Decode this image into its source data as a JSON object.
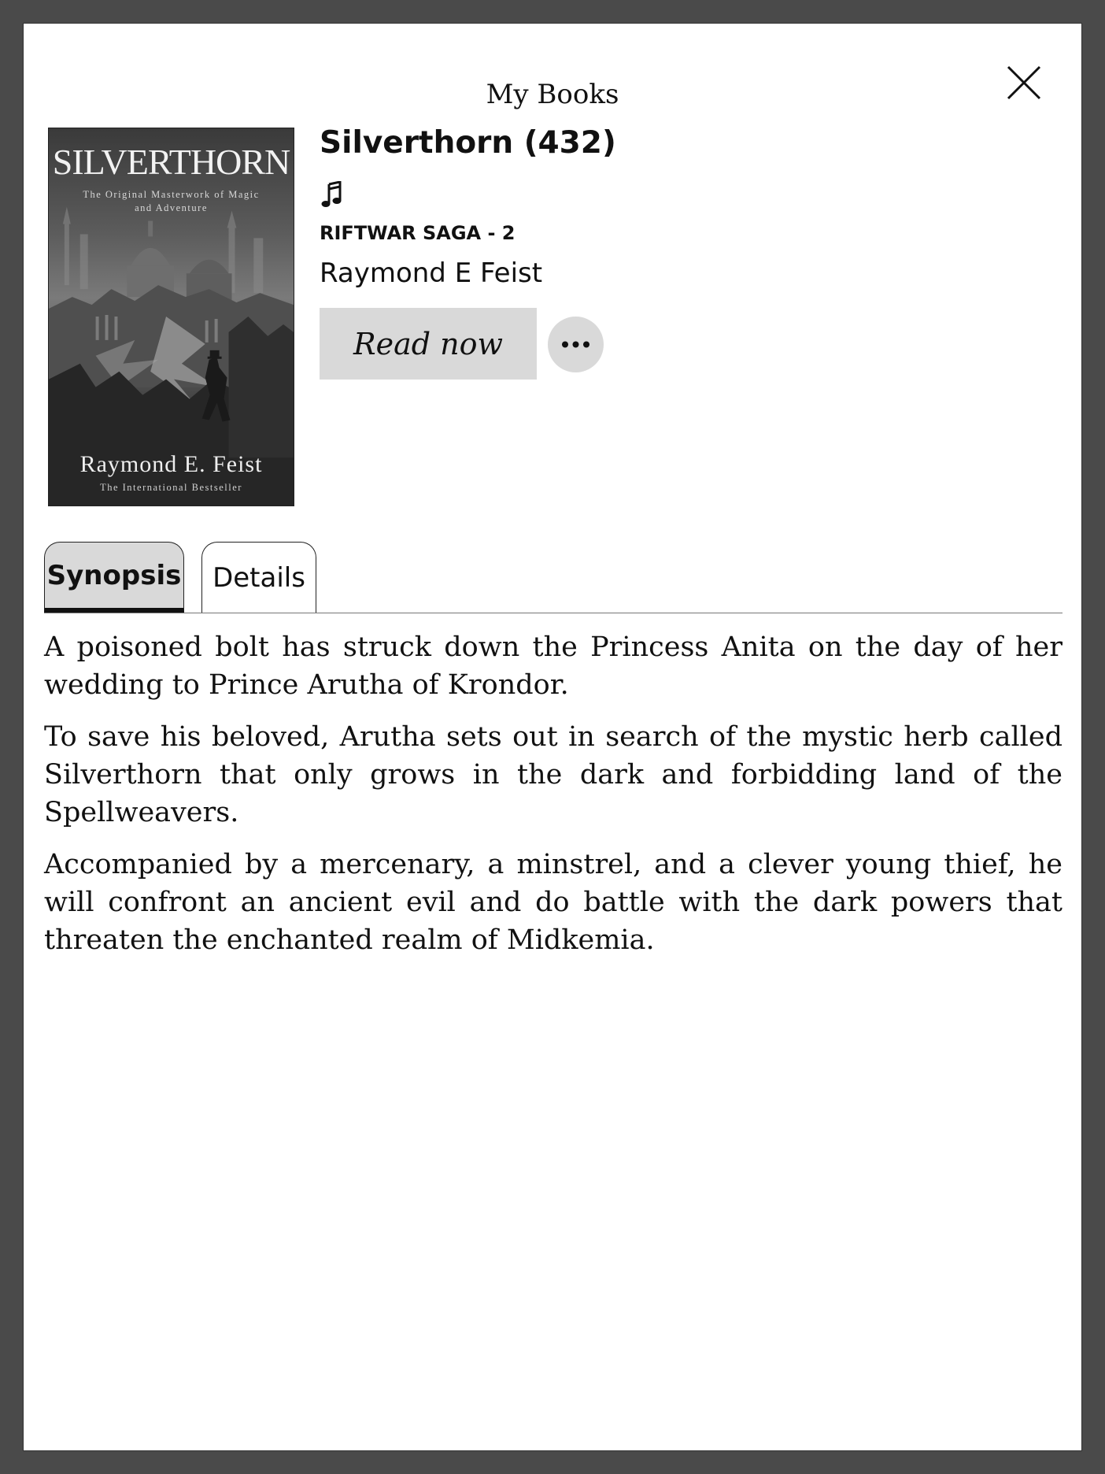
{
  "header": {
    "title": "My Books",
    "close_icon": "close-icon"
  },
  "cover": {
    "title": "SILVERTHORN",
    "tagline": "The Original Masterwork of Magic and Adventure",
    "author": "Raymond E. Feist",
    "bestseller": "The International Bestseller"
  },
  "book": {
    "title": "Silverthorn (432)",
    "audio_icon": "music-note-icon",
    "series": "RIFTWAR SAGA - 2",
    "author": "Raymond E Feist"
  },
  "actions": {
    "read_now_label": "Read now",
    "more_icon": "more-options-icon"
  },
  "tabs": [
    {
      "label": "Synopsis",
      "active": true
    },
    {
      "label": "Details",
      "active": false
    }
  ],
  "synopsis": {
    "paragraphs": [
      "A poisoned bolt has struck down the Princess Anita on the day of her wedding to Prince Arutha of Krondor.",
      "To save his beloved, Arutha sets out in search of the mystic herb called Silverthorn that only grows in the dark and forbidding land of the Spellweavers.",
      "Accompanied by a mercenary, a minstrel, and a clever young thief, he will confront an ancient evil and do battle with the dark powers that threaten the enchanted realm of Midkemia."
    ]
  },
  "colors": {
    "backdrop": "#4a4a4a",
    "panel": "#ffffff",
    "button_fill": "#d9d9d9",
    "text": "#111111"
  }
}
